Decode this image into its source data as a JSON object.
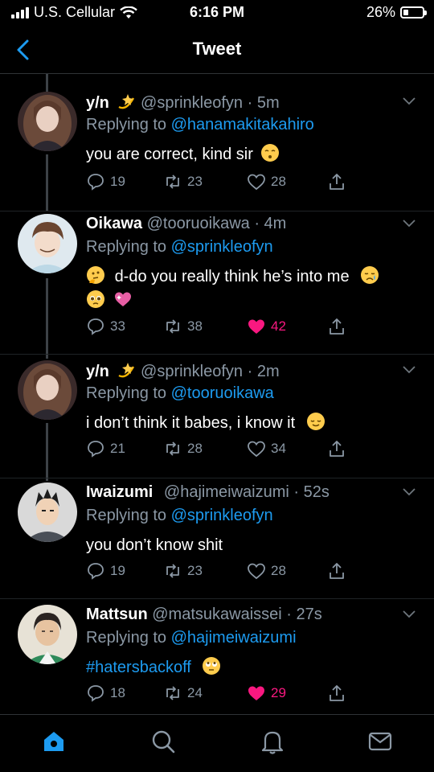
{
  "status_bar": {
    "carrier": "U.S. Cellular",
    "time": "6:16 PM",
    "battery": "26%",
    "battery_level": 0.26
  },
  "nav": {
    "title": "Tweet",
    "back_icon": "chevron-left-icon"
  },
  "tweets": [
    {
      "name": "y/n",
      "name_emoji": "dizzy-emoji",
      "handle": "@sprinkleofyn",
      "time": "· 5m",
      "replying_prefix": "Replying to",
      "replying_to": "@hanamakitakahiro",
      "text": "you are correct, kind sir",
      "text_emoji": "kissing-face-emoji",
      "replies": "19",
      "retweets": "23",
      "likes": "28",
      "liked": false
    },
    {
      "name": "Oikawa",
      "handle": "@tooruoikawa",
      "time": "· 4m",
      "replying_prefix": "Replying to",
      "replying_to": "@sprinkleofyn",
      "text": "d-do you really think he’s into me",
      "text_emoji": [
        "thinking-face-emoji",
        "sad-sweat-face-emoji",
        "pleading-face-emoji",
        "sparkling-heart-emoji"
      ],
      "replies": "33",
      "retweets": "38",
      "likes": "42",
      "liked": true
    },
    {
      "name": "y/n",
      "name_emoji": "dizzy-emoji",
      "handle": "@sprinkleofyn",
      "time": "· 2m",
      "replying_prefix": "Replying to",
      "replying_to": "@tooruoikawa",
      "text": "i don’t think it babes, i know it",
      "text_emoji": "relieved-face-emoji",
      "replies": "21",
      "retweets": "28",
      "likes": "34",
      "liked": false
    },
    {
      "name": "Iwaizumi",
      "handle": "@hajimeiwaizumi",
      "time": "· 52s",
      "replying_prefix": "Replying to",
      "replying_to": "@sprinkleofyn",
      "text": "you don’t know shit",
      "replies": "19",
      "retweets": "23",
      "likes": "28",
      "liked": false
    },
    {
      "name": "Mattsun",
      "handle": "@matsukawaissei",
      "time": "· 27s",
      "replying_prefix": "Replying to",
      "replying_to": "@hajimeiwaizumi",
      "text": "#hatersbackoff",
      "text_emoji": "eye-roll-face-emoji",
      "replies": "18",
      "retweets": "24",
      "likes": "29",
      "liked": true
    }
  ],
  "tab_bar": {
    "items": [
      "home-icon",
      "search-icon",
      "notifications-icon",
      "messages-icon"
    ],
    "active": "home-icon"
  },
  "colors": {
    "background": "#000000",
    "link": "#1d9bf0",
    "secondary_text": "#8b98a5",
    "like": "#f91880",
    "divider": "#2f3336"
  }
}
